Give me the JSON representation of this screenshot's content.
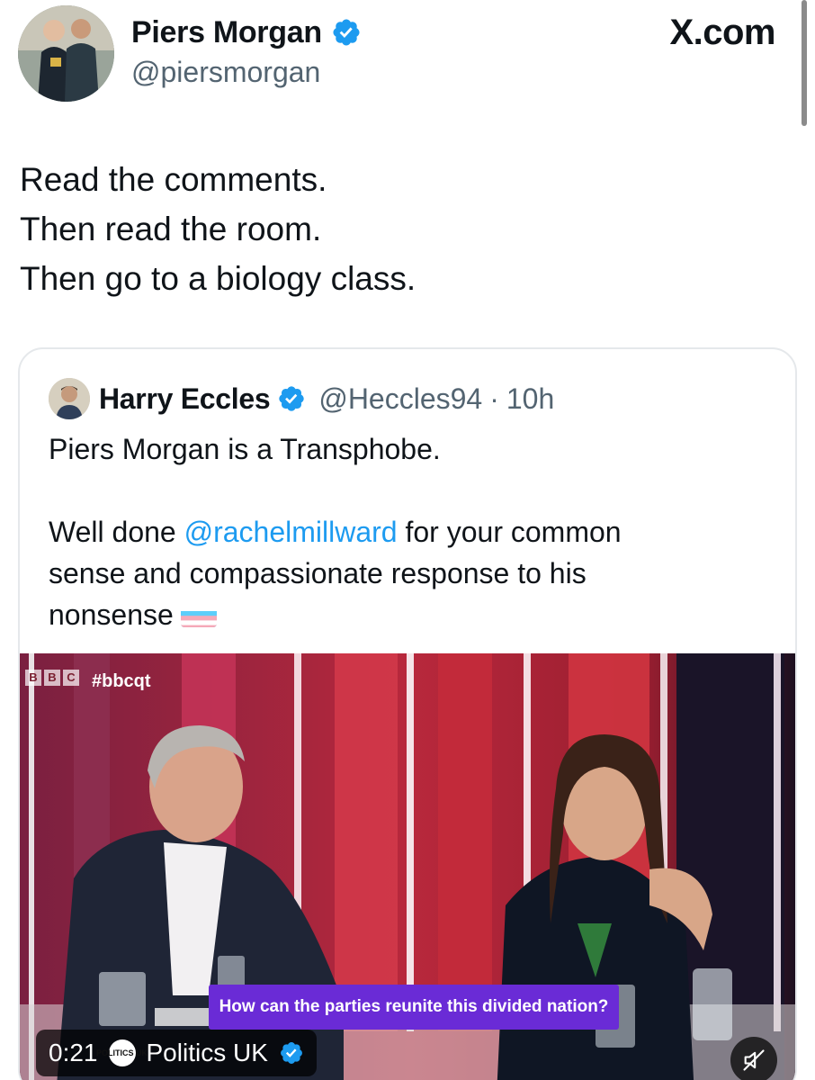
{
  "site": {
    "label": "X.com"
  },
  "author": {
    "name": "Piers Morgan",
    "handle": "@piersmorgan",
    "verified": true
  },
  "tweet": {
    "lines": [
      "Read the comments.",
      "Then read the room.",
      "Then go to a biology class."
    ]
  },
  "quoted": {
    "name": "Harry Eccles",
    "handle": "@Heccles94",
    "separator": "·",
    "time": "10h",
    "verified": true,
    "line1": "Piers Morgan is a Transphobe.",
    "line2_prefix": "Well done ",
    "mention": "@rachelmillward",
    "line2_suffix": " for your common",
    "line3": "sense and compassionate response to his",
    "line4": "nonsense",
    "emoji": "transgender-flag"
  },
  "media": {
    "hashtag": "#bbcqt",
    "channel_logo": [
      "B",
      "B",
      "C"
    ],
    "caption": "How can the parties reunite this divided nation?",
    "duration": "0:21",
    "source_logo": "POLITICS UK",
    "source_name": "Politics UK",
    "source_verified": true,
    "muted": true
  },
  "colors": {
    "text": "#0f1419",
    "secondary": "#536471",
    "link": "#1d9bf0",
    "verified": "#1d9bf0",
    "caption_bg": "#6a2bd6"
  }
}
